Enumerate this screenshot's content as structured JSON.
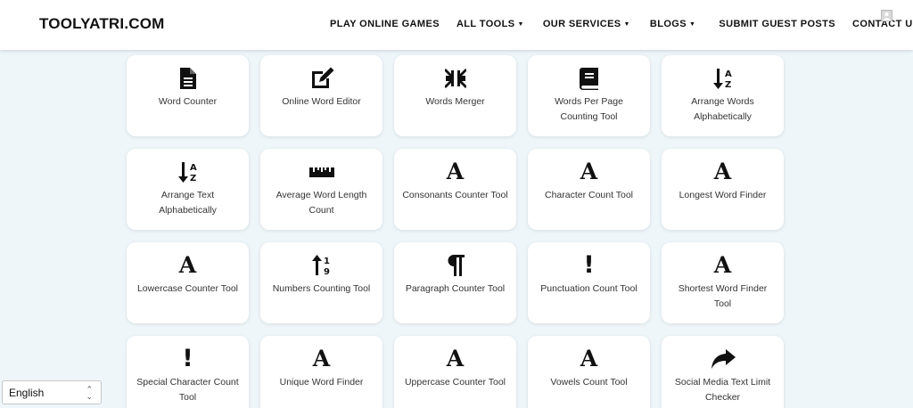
{
  "header": {
    "logo": "TOOLYATRI.COM",
    "nav": [
      {
        "label": "PLAY ONLINE GAMES",
        "dropdown": false
      },
      {
        "label": "ALL TOOLS",
        "dropdown": true
      },
      {
        "label": "OUR SERVICES",
        "dropdown": true
      },
      {
        "label": "BLOGS",
        "dropdown": true
      },
      {
        "label": "SUBMIT GUEST POSTS",
        "dropdown": false
      },
      {
        "label": "CONTACT US",
        "dropdown": false
      }
    ],
    "user_icon": "user-icon"
  },
  "tools": [
    {
      "label": "Word Counter",
      "icon": "document-icon"
    },
    {
      "label": "Online Word Editor",
      "icon": "edit-icon"
    },
    {
      "label": "Words Merger",
      "icon": "compress-icon"
    },
    {
      "label": "Words Per Page Counting Tool",
      "icon": "book-icon"
    },
    {
      "label": "Arrange Words Alphabetically",
      "icon": "sort-alpha-icon"
    },
    {
      "label": "Arrange Text Alphabetically",
      "icon": "sort-alpha-icon"
    },
    {
      "label": "Average Word Length Count",
      "icon": "ruler-icon"
    },
    {
      "label": "Consonants Counter Tool",
      "icon": "letter-a-icon"
    },
    {
      "label": "Character Count Tool",
      "icon": "letter-a-icon"
    },
    {
      "label": "Longest Word Finder",
      "icon": "letter-a-icon"
    },
    {
      "label": "Lowercase Counter Tool",
      "icon": "letter-a-icon"
    },
    {
      "label": "Numbers Counting Tool",
      "icon": "sort-numeric-icon"
    },
    {
      "label": "Paragraph Counter Tool",
      "icon": "paragraph-icon"
    },
    {
      "label": "Punctuation Count Tool",
      "icon": "exclamation-icon"
    },
    {
      "label": "Shortest Word Finder Tool",
      "icon": "letter-a-icon"
    },
    {
      "label": "Special Character Count Tool",
      "icon": "exclamation-icon"
    },
    {
      "label": "Unique Word Finder",
      "icon": "letter-a-icon"
    },
    {
      "label": "Uppercase Counter Tool",
      "icon": "letter-a-icon"
    },
    {
      "label": "Vowels Count Tool",
      "icon": "letter-a-icon"
    },
    {
      "label": "Social Media Text Limit Checker",
      "icon": "share-icon"
    }
  ],
  "language_selector": {
    "value": "English"
  },
  "colors": {
    "background": "#eef6fa",
    "card": "#ffffff",
    "text": "#111111"
  }
}
